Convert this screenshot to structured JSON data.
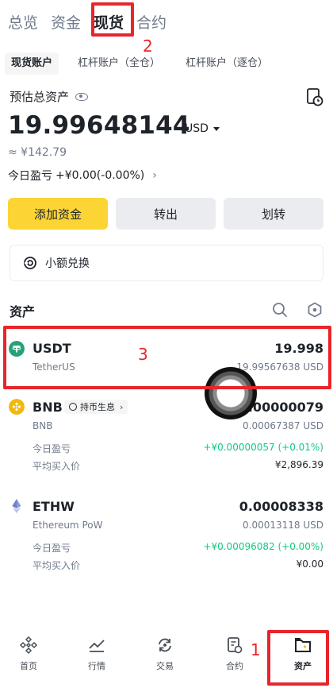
{
  "top_tabs": [
    "总览",
    "资金",
    "现货",
    "合约"
  ],
  "sub_tabs": [
    "现货账户",
    "杠杆账户（全仓）",
    "杠杆账户（逐仓）"
  ],
  "summary": {
    "est_label": "预估总资产",
    "balance": "19.99648144",
    "currency": "USD",
    "cny_value": "≈ ¥142.79",
    "pnl_label": "今日盈亏",
    "pnl_value": "+¥0.00(-0.00%)"
  },
  "actions": {
    "add_funds": "添加资金",
    "withdraw": "转出",
    "transfer": "划转"
  },
  "convert_label": "小额兑换",
  "assets_title": "资产",
  "assets": [
    {
      "symbol": "USDT",
      "name": "TetherUS",
      "amount": "19.998",
      "cny": "19.99567638 USD",
      "color": "#26a17b"
    },
    {
      "symbol": "BNB",
      "name": "BNB",
      "badge": "持币生息",
      "amount": "0.00000079",
      "cny": "0.00067387 USD",
      "pnl_label": "今日盈亏",
      "pnl_value": "+¥0.00000057 (+0.01%)",
      "avg_label": "平均买入价",
      "avg_value": "¥2,896.39",
      "color": "#f0b90b"
    },
    {
      "symbol": "ETHW",
      "name": "Ethereum PoW",
      "amount": "0.00008338",
      "cny": "0.00013118 USD",
      "pnl_label": "今日盈亏",
      "pnl_value": "+¥0.00096082 (+0.00%)",
      "avg_label": "平均买入价",
      "avg_value": "¥0.00",
      "color": "#8a9bd6"
    }
  ],
  "nav": [
    "首页",
    "行情",
    "交易",
    "合约",
    "资产"
  ],
  "annotations": [
    "1",
    "2",
    "3"
  ],
  "colors": {
    "accent_yellow": "#fcd535",
    "annotation_red": "#e8252b",
    "positive_green": "#0ecb81"
  }
}
